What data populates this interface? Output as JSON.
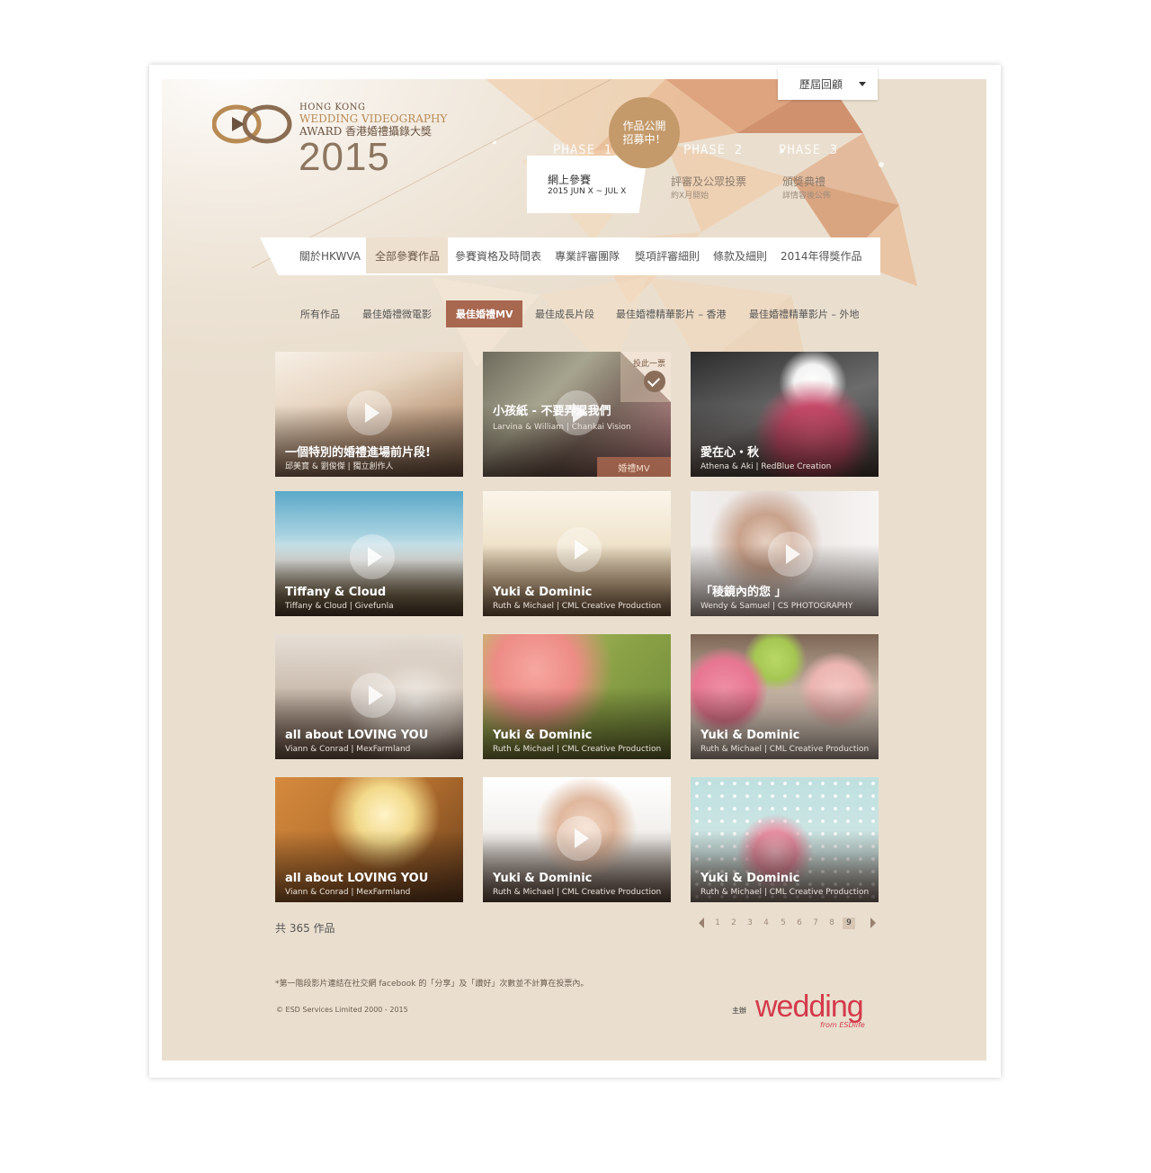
{
  "history_dropdown": {
    "label": "歷屆回顧"
  },
  "logo": {
    "line1": "HONG KONG",
    "line2": "WEDDING VIDEOGRAPHY",
    "line3": "AWARD 香港婚禮攝錄大獎",
    "year": "2015"
  },
  "phases": {
    "badge_line1": "作品公開",
    "badge_line2": "招募中！",
    "items": [
      {
        "label": "PHASE 1",
        "title": "網上參賽",
        "date": "2015 JUN X ~ JUL X"
      },
      {
        "label": "PHASE 2",
        "title": "評審及公眾投票",
        "date": "約X月開始"
      },
      {
        "label": "PHASE 3",
        "title": "頒獎典禮",
        "date": "詳情容後公佈"
      }
    ]
  },
  "main_nav": [
    {
      "label": "關於HKWVA"
    },
    {
      "label": "全部參賽作品",
      "active": true
    },
    {
      "label": "參賽資格及時間表"
    },
    {
      "label": "專業評審團隊"
    },
    {
      "label": "獎項評審細則"
    },
    {
      "label": "條款及細則"
    },
    {
      "label": "2014年得獎作品"
    }
  ],
  "sub_nav": [
    {
      "label": "所有作品"
    },
    {
      "label": "最佳婚禮微電影"
    },
    {
      "label": "最佳婚禮MV",
      "active": true
    },
    {
      "label": "最佳成長片段"
    },
    {
      "label": "最佳婚禮精華影片 – 香港"
    },
    {
      "label": "最佳婚禮精華影片 – 外地"
    }
  ],
  "cards": [
    {
      "title": "一個特別的婚禮進場前片段!",
      "subtitle": "邱美寶 & 劉俊傑 | 獨立創作人"
    },
    {
      "title": "小孩紙 - 不要弄混我們",
      "subtitle": "Larvina & William | Chankai Vision",
      "vote_label": "投此一票",
      "tag": "婚禮MV"
    },
    {
      "title": "愛在心・秋",
      "subtitle": "Athena & Aki | RedBlue Creation"
    },
    {
      "title": "Tiffany & Cloud",
      "subtitle": "Tiffany & Cloud | Givefunla"
    },
    {
      "title": "Yuki & Dominic",
      "subtitle": "Ruth & Michael | CML Creative Production"
    },
    {
      "title": "「稜鏡內的您 」",
      "subtitle": "Wendy & Samuel | CS PHOTOGRAPHY"
    },
    {
      "title": "all about LOVING YOU",
      "subtitle": "Viann & Conrad | MexFarmland"
    },
    {
      "title": "Yuki & Dominic",
      "subtitle": "Ruth & Michael | CML Creative Production"
    },
    {
      "title": "Yuki & Dominic",
      "subtitle": "Ruth & Michael | CML Creative Production"
    },
    {
      "title": "all about LOVING YOU",
      "subtitle": "Viann & Conrad | MexFarmland"
    },
    {
      "title": "Yuki & Dominic",
      "subtitle": "Ruth & Michael | CML Creative Production"
    },
    {
      "title": "Yuki & Dominic",
      "subtitle": "Ruth & Michael | CML Creative Production"
    }
  ],
  "total": {
    "text": "共 365 作品"
  },
  "pagination": {
    "pages": [
      "1",
      "2",
      "3",
      "4",
      "5",
      "6",
      "7",
      "8",
      "9"
    ],
    "current": "9"
  },
  "footnote": "*第一階段影片連結在社交網 facebook 的「分享」及「讚好」次數並不計算在投票內。",
  "copyright": "© ESD Services Limited 2000 - 2015",
  "host_label": "主辦",
  "brand": {
    "name": "wedding",
    "from": "from ESDlife",
    "color": "#d43a4b"
  },
  "colors": {
    "accent": "#a8674f",
    "background": "#eadfcf"
  }
}
